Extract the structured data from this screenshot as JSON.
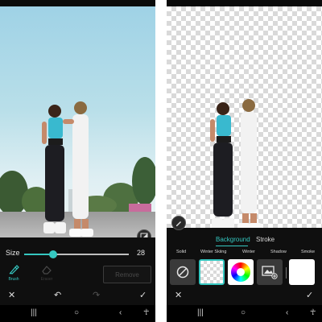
{
  "left_screen": {
    "size_label": "Size",
    "size_value": "28",
    "size_fraction": 0.28,
    "tools": [
      {
        "label": "Brush",
        "icon": "brush-icon",
        "active": true
      },
      {
        "label": "Eraser",
        "icon": "eraser-icon",
        "active": false
      }
    ],
    "remove_label": "Remove",
    "icons": {
      "close": "close-icon",
      "undo": "undo-icon",
      "redo": "redo-icon",
      "confirm": "check-icon",
      "compare": "compare-icon"
    }
  },
  "right_screen": {
    "tabs": [
      {
        "label": "Background",
        "active": true
      },
      {
        "label": "Stroke",
        "active": false
      }
    ],
    "background_options": [
      {
        "label": "Solid",
        "icon": "none-icon"
      },
      {
        "label": "Winter Skiing",
        "icon": "transparent-swatch"
      },
      {
        "label": "Winter",
        "icon": "color-wheel-icon"
      },
      {
        "label": "Shadow",
        "icon": "image-add-icon"
      },
      {
        "label": "Smoke",
        "icon": "white-swatch"
      }
    ],
    "icons": {
      "edit": "pencil-icon",
      "close": "close-icon",
      "confirm": "check-icon"
    }
  },
  "system_nav": {
    "icons": [
      "recents-icon",
      "home-icon",
      "back-icon",
      "accessibility-icon"
    ]
  },
  "colors": {
    "accent": "#35c7c0",
    "background": "#0f0f0f",
    "selected_swatch_border": "#35c7c0"
  }
}
